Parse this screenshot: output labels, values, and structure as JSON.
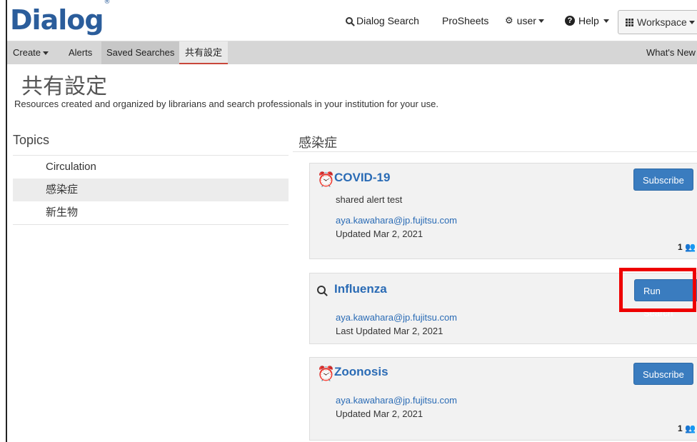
{
  "brand": {
    "name": "Dialog",
    "mark": "®"
  },
  "topnav": {
    "search": "Dialog Search",
    "prosheets": "ProSheets",
    "user": "user",
    "help": "Help",
    "workspace": "Workspace"
  },
  "subnav": {
    "create": "Create",
    "alerts": "Alerts",
    "saved": "Saved Searches",
    "shared": "共有設定",
    "whats_new": "What's New"
  },
  "page": {
    "title": "共有設定",
    "description": "Resources created and organized by librarians and search professionals in your institution for your use."
  },
  "topics": {
    "heading": "Topics",
    "items": [
      "Circulation",
      "感染症",
      "新生物"
    ],
    "selected_index": 1
  },
  "section": {
    "heading": "感染症"
  },
  "cards": [
    {
      "icon": "alarm-clock-icon",
      "title": "COVID-19",
      "description": "shared alert test",
      "email": "aya.kawahara@jp.fujitsu.com",
      "updated": "Updated Mar 2, 2021",
      "button": "Subscribe",
      "count": "1"
    },
    {
      "icon": "search-icon",
      "title": "Influenza",
      "email": "aya.kawahara@jp.fujitsu.com",
      "updated": "Last Updated Mar 2, 2021",
      "button": "Run Search"
    },
    {
      "icon": "alarm-clock-icon",
      "title": "Zoonosis",
      "email": "aya.kawahara@jp.fujitsu.com",
      "updated": "Updated Mar 2, 2021",
      "button": "Subscribe",
      "count": "1"
    }
  ],
  "colors": {
    "brand": "#2b5d9b",
    "link": "#2a6bb5",
    "button": "#3a7cbf",
    "highlight": "#ee0000",
    "active_tab": "#c8473b"
  }
}
